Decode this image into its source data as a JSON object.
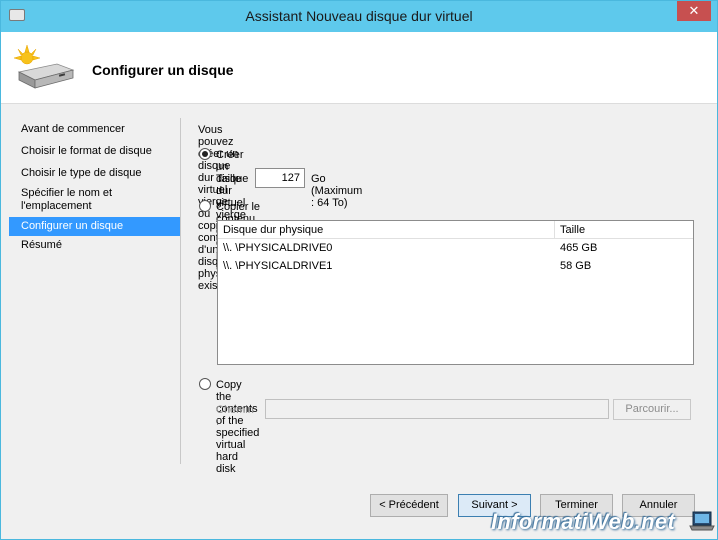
{
  "window": {
    "title": "Assistant Nouveau disque dur virtuel",
    "close_glyph": "✕"
  },
  "header": {
    "heading": "Configurer un disque",
    "icon": "disk-with-sun-icon"
  },
  "nav": {
    "items": [
      {
        "label": "Avant de commencer"
      },
      {
        "label": "Choisir le format de disque"
      },
      {
        "label": "Choisir le type de disque"
      },
      {
        "label": "Spécifier le nom et l'emplacement"
      },
      {
        "label": "Configurer un disque"
      },
      {
        "label": "Résumé"
      }
    ],
    "active_index": 4
  },
  "main": {
    "intro": "Vous pouvez créer un disque dur virtuel vierge ou copier le contenu d'un disque physique existant.",
    "option_blank": {
      "label": "Créer un disque dur virtuel vierge",
      "checked": true
    },
    "size": {
      "label": "Taille :",
      "value": "127",
      "unit": "Go (Maximum : 64 To)"
    },
    "option_copy_physical": {
      "label": "Copier le contenu du disque physique spécifié :",
      "checked": false
    },
    "physical_table": {
      "columns": [
        "Disque dur physique",
        "Taille"
      ],
      "rows": [
        {
          "disk": "\\\\. \\PHYSICALDRIVE0",
          "size": "465 GB"
        },
        {
          "disk": "\\\\. \\PHYSICALDRIVE1",
          "size": "58 GB"
        }
      ]
    },
    "option_copy_vhd": {
      "label": "Copy the contents of the specified virtual hard disk",
      "checked": false
    },
    "path": {
      "label": "Chemin :",
      "value": "",
      "browse_label": "Parcourir..."
    }
  },
  "footer": {
    "prev_label": "< Précédent",
    "next_label": "Suivant >",
    "finish_label": "Terminer",
    "cancel_label": "Annuler"
  },
  "watermark": {
    "text": "InformatiWeb.net"
  },
  "colors": {
    "titlebar": "#5ec9ec",
    "nav_active": "#3399ff",
    "window_bg": "#f0f0f0"
  }
}
